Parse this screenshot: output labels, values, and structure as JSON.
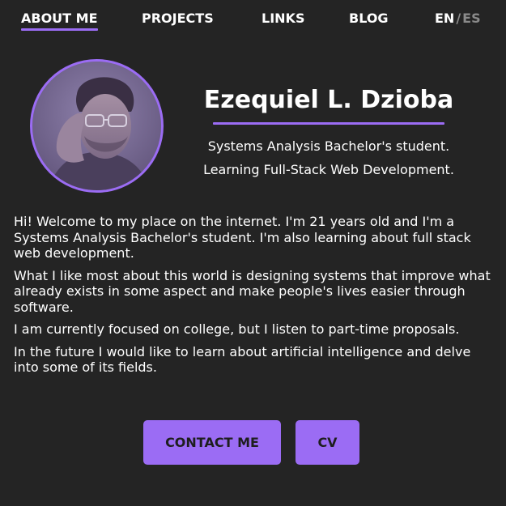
{
  "nav": {
    "items": [
      {
        "label": "ABOUT ME",
        "active": true
      },
      {
        "label": "PROJECTS",
        "active": false
      },
      {
        "label": "LINKS",
        "active": false
      },
      {
        "label": "BLOG",
        "active": false
      }
    ],
    "language": {
      "current": "EN",
      "separator": "/",
      "other": "ES"
    }
  },
  "profile": {
    "name": "Ezequiel L. Dzioba",
    "subtitle_lines": [
      "Systems Analysis Bachelor's student.",
      "Learning Full-Stack Web Development."
    ]
  },
  "bio": {
    "paragraphs": [
      "Hi! Welcome to my place on the internet. I'm 21 years old and I'm a Systems Analysis Bachelor's student. I'm also learning about full stack web development.",
      "What I like most about this world is designing systems that improve what already exists in some aspect and make people's lives easier through software.",
      "I am currently focused on college, but I listen to part-time proposals.",
      "In the future I would like to learn about artificial intelligence and delve into some of its fields."
    ]
  },
  "actions": {
    "contact_label": "CONTACT ME",
    "cv_label": "CV"
  },
  "colors": {
    "background": "#242424",
    "accent": "#9b6cf4",
    "text": "#ffffff",
    "muted": "#8a8a8a",
    "button_text": "#1e1e1e"
  }
}
